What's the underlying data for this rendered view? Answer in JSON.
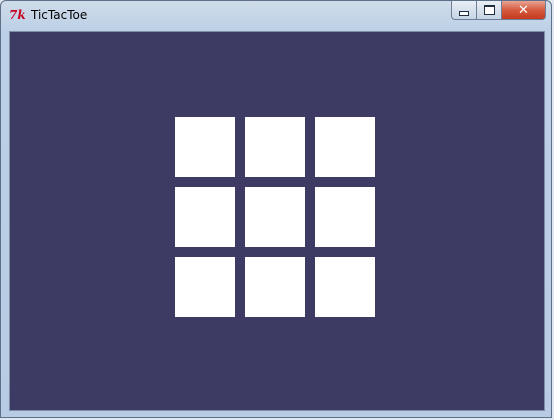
{
  "window": {
    "title": "TicTacToe",
    "icon": "tk-feather-icon",
    "controls": {
      "minimize": "minimize-icon",
      "maximize": "maximize-icon",
      "close": "close-icon",
      "close_glyph": "✕"
    }
  },
  "colors": {
    "background": "#3d3b64",
    "cell": "#ffffff"
  },
  "board": {
    "rows": 3,
    "cols": 3,
    "cells": [
      "",
      "",
      "",
      "",
      "",
      "",
      "",
      "",
      ""
    ]
  }
}
